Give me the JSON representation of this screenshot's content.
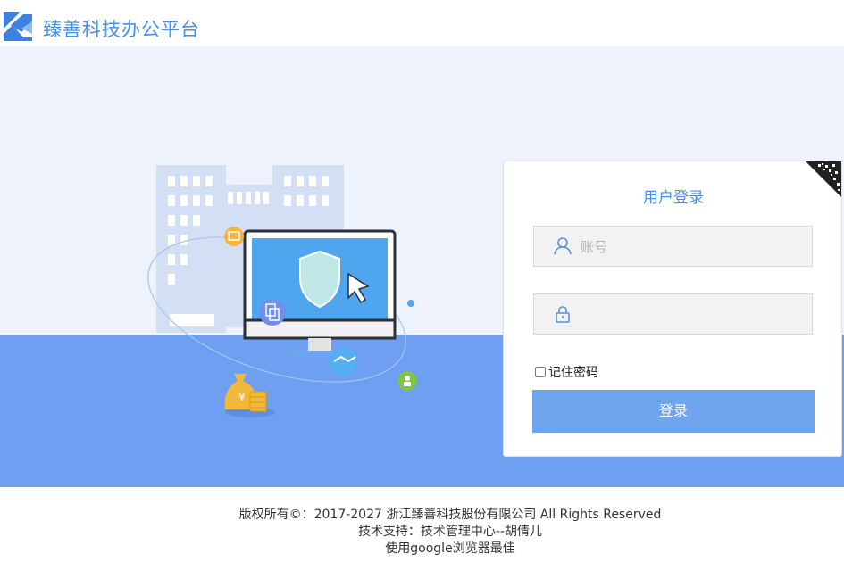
{
  "header": {
    "brand": "臻善科技办公平台"
  },
  "login": {
    "title": "用户登录",
    "username_placeholder": "账号",
    "password_placeholder": "",
    "remember_label": "记住密码",
    "remember_checked": false,
    "submit_label": "登录"
  },
  "footer": {
    "copyright": "版权所有©：2017-2027 浙江臻善科技股份有限公司 All Rights Reserved",
    "support": "技术支持：技术管理中心--胡倩儿",
    "browser": "使用google浏览器最佳"
  },
  "colors": {
    "accent": "#4a8fe6",
    "button": "#6fa4ee",
    "ground": "#6f9ff0",
    "background": "#eef2fb"
  },
  "icons": [
    "logo-icon",
    "qrcode-icon",
    "user-icon",
    "lock-icon",
    "shield-icon",
    "cursor-icon",
    "money-bag-icon",
    "handshake-icon",
    "copy-icon",
    "chart-icon",
    "person-icon"
  ]
}
